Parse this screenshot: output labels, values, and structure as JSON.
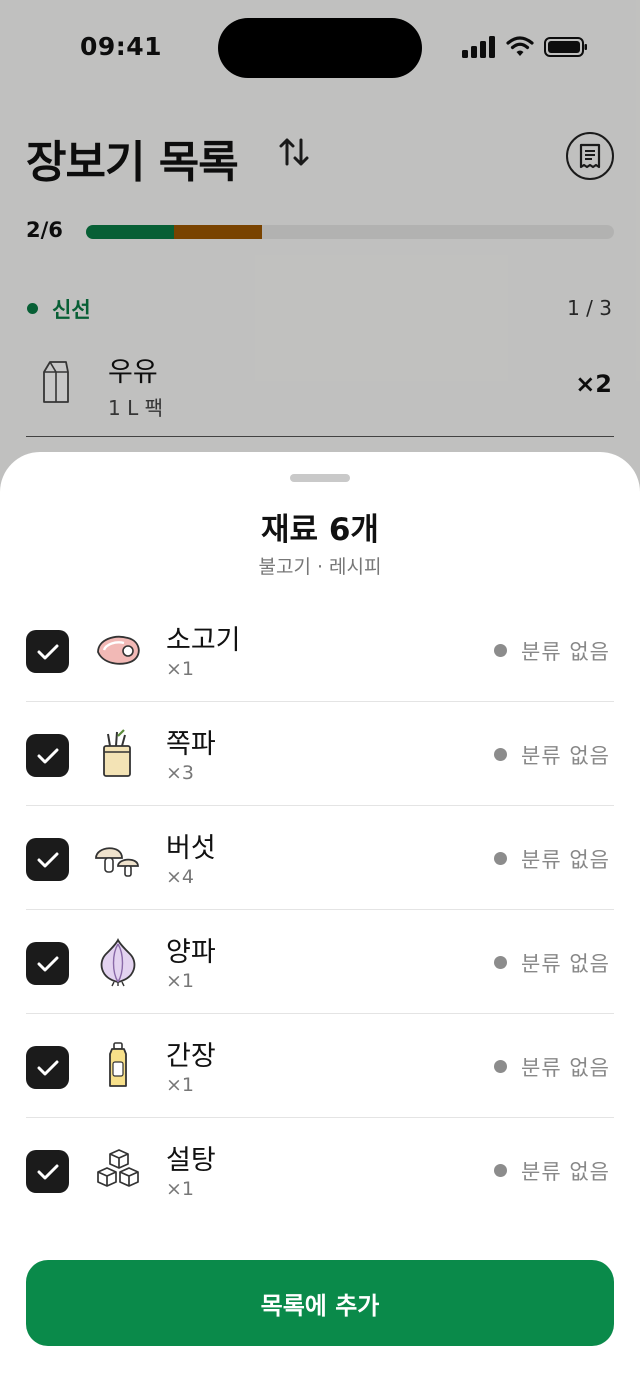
{
  "status_bar": {
    "time": "09:41"
  },
  "header": {
    "title": "장보기 목록"
  },
  "progress": {
    "label": "2/6",
    "fresh_fraction": 0.1667,
    "other_fraction": 0.1667,
    "fresh_color": "#0a7a45",
    "other_color": "#9b5600"
  },
  "section": {
    "title": "신선",
    "count": "1 / 3",
    "color": "#0a7a45"
  },
  "background_item": {
    "name": "우유",
    "detail": "1 L 팩",
    "qty": "×2",
    "icon": "milk-carton-icon"
  },
  "sheet": {
    "title": "재료 6개",
    "subtitle": "불고기 · 레시피",
    "items": [
      {
        "name": "소고기",
        "qty": "×1",
        "category": "분류 없음",
        "checked": true,
        "icon": "steak-icon"
      },
      {
        "name": "쪽파",
        "qty": "×3",
        "category": "분류 없음",
        "checked": true,
        "icon": "grocery-bag-icon"
      },
      {
        "name": "버섯",
        "qty": "×4",
        "category": "분류 없음",
        "checked": true,
        "icon": "mushroom-icon"
      },
      {
        "name": "양파",
        "qty": "×1",
        "category": "분류 없음",
        "checked": true,
        "icon": "onion-icon"
      },
      {
        "name": "간장",
        "qty": "×1",
        "category": "분류 없음",
        "checked": true,
        "icon": "sauce-bottle-icon"
      },
      {
        "name": "설탕",
        "qty": "×1",
        "category": "분류 없음",
        "checked": true,
        "icon": "sugar-cubes-icon"
      }
    ],
    "cta_label": "목록에 추가",
    "accent": "#0a8a4a"
  }
}
